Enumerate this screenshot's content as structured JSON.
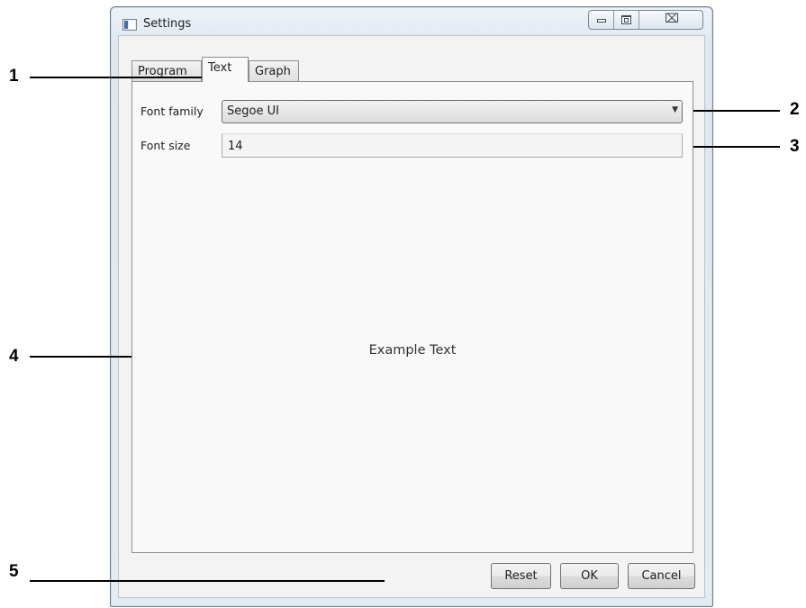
{
  "window": {
    "title": "Settings",
    "close_symbol": "⌧"
  },
  "tabs": [
    {
      "label": "Program",
      "selected": false
    },
    {
      "label": "Text",
      "selected": true
    },
    {
      "label": "Graph",
      "selected": false
    }
  ],
  "text_tab": {
    "font_family_label": "Font family",
    "font_family_value": "Segoe UI",
    "font_size_label": "Font size",
    "font_size_value": "14",
    "preview_text": "Example Text"
  },
  "buttons": {
    "reset": "Reset",
    "ok": "OK",
    "cancel": "Cancel"
  },
  "callouts": [
    "1",
    "2",
    "3",
    "4",
    "5"
  ]
}
